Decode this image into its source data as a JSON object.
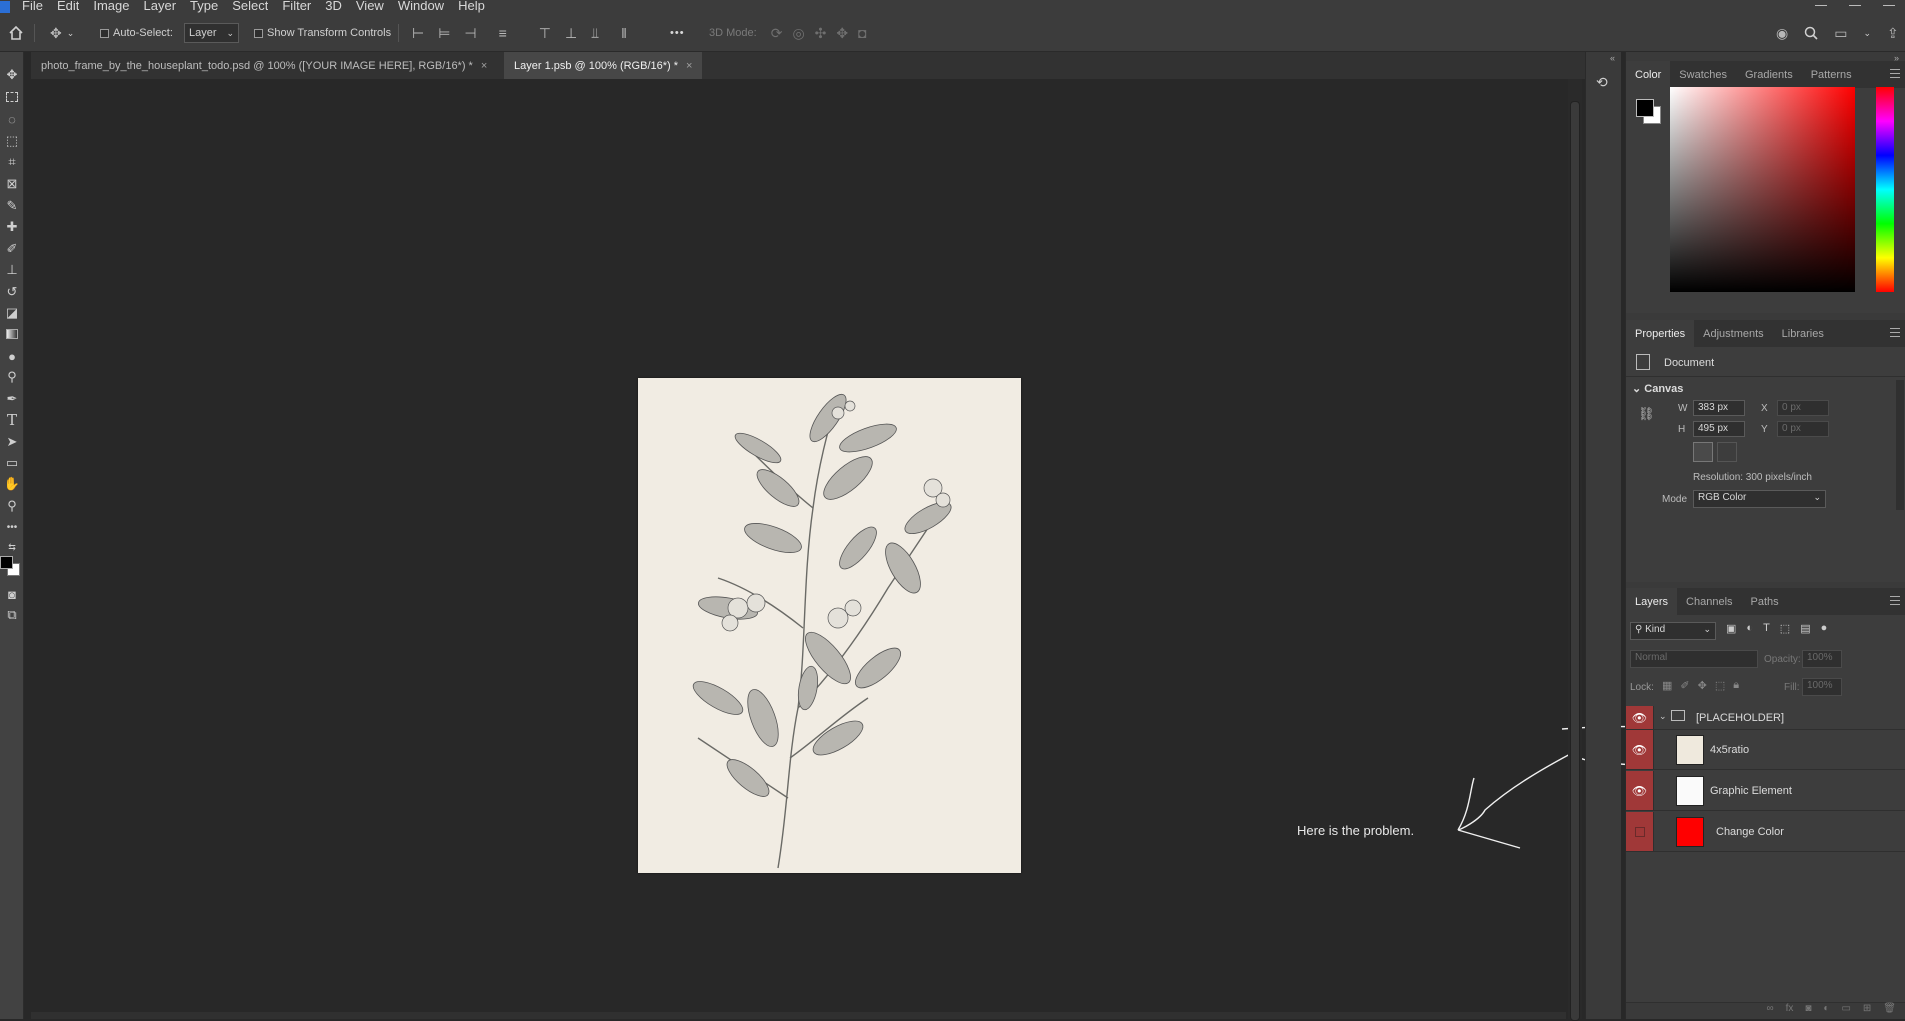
{
  "menubar": {
    "items": [
      "File",
      "Edit",
      "Image",
      "Layer",
      "Type",
      "Select",
      "Filter",
      "3D",
      "View",
      "Window",
      "Help"
    ]
  },
  "options": {
    "auto_select_label": "Auto-Select:",
    "auto_select_value": "Layer",
    "show_transform_label": "Show Transform Controls",
    "more_label": "•••",
    "mode_3d_label": "3D Mode:"
  },
  "tabs": [
    {
      "label": "photo_frame_by_the_houseplant_todo.psd @ 100% ([YOUR IMAGE HERE], RGB/16*) *",
      "close": "×"
    },
    {
      "label": "Layer 1.psb @ 100% (RGB/16*) *",
      "close": "×"
    }
  ],
  "annotation": {
    "text": "Here is the problem."
  },
  "color_panel": {
    "tabs": [
      "Color",
      "Swatches",
      "Gradients",
      "Patterns"
    ],
    "foreground": "#000000",
    "background": "#ffffff",
    "hue_color": "#ff0000"
  },
  "properties": {
    "tabs": [
      "Properties",
      "Adjustments",
      "Libraries"
    ],
    "doc_label": "Document",
    "section": "Canvas",
    "w_label": "W",
    "w_value": "383 px",
    "h_label": "H",
    "h_value": "495 px",
    "x_label": "X",
    "x_placeholder": "0 px",
    "y_label": "Y",
    "y_placeholder": "0 px",
    "resolution": "Resolution: 300 pixels/inch",
    "mode_label": "Mode",
    "mode_value": "RGB Color"
  },
  "layers_panel": {
    "tabs": [
      "Layers",
      "Channels",
      "Paths"
    ],
    "filter_label": "Kind",
    "blend_mode": "Normal",
    "opacity_label": "Opacity:",
    "opacity_value": "100%",
    "lock_label": "Lock:",
    "fill_label": "Fill:",
    "fill_value": "100%",
    "layers": [
      {
        "name": "[PLACEHOLDER]",
        "visible": true,
        "type": "group"
      },
      {
        "name": "4x5ratio",
        "visible": true,
        "type": "smart"
      },
      {
        "name": "Graphic Element",
        "visible": true,
        "type": "smart"
      },
      {
        "name": "Change Color",
        "visible": false,
        "type": "fill",
        "swatch": "#ff0000"
      }
    ]
  }
}
